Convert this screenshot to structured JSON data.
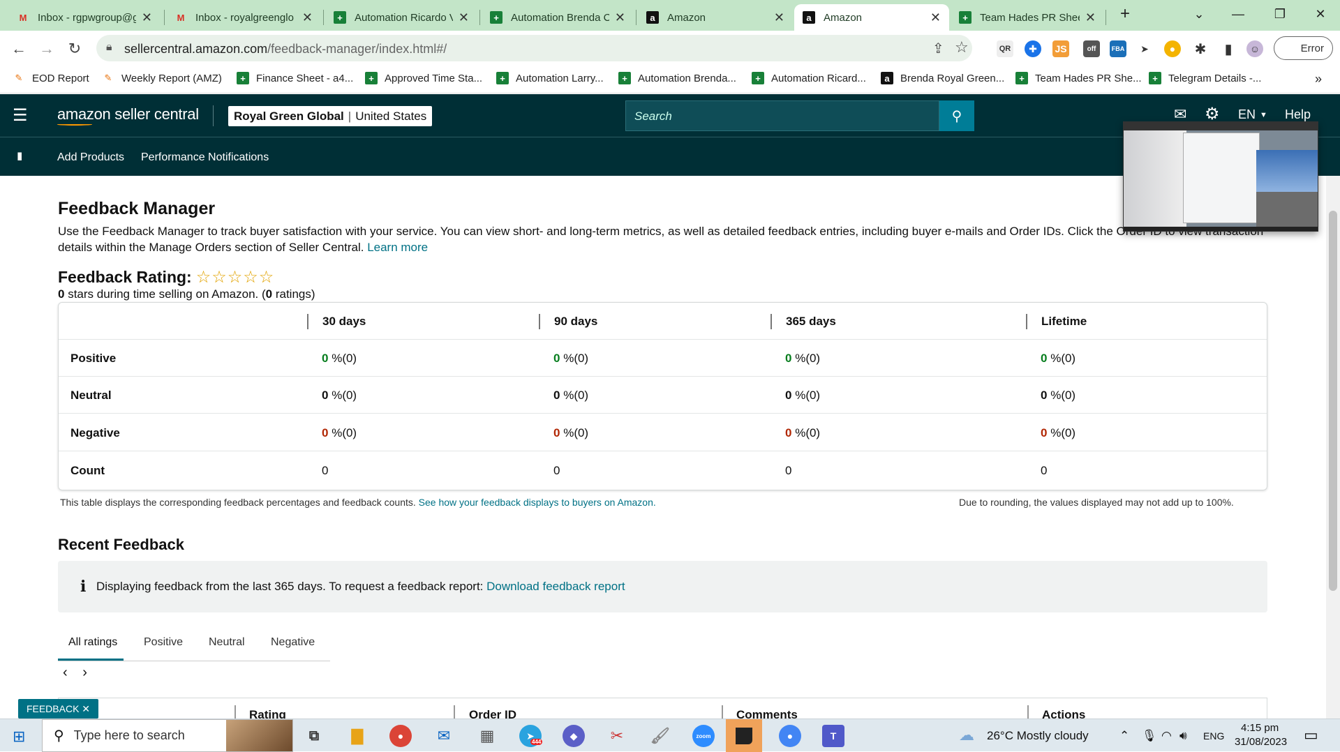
{
  "browser": {
    "tabs": [
      {
        "title": "Inbox - rgpwgroup@g",
        "icon": "gmail-icon"
      },
      {
        "title": "Inbox - royalgreenglo",
        "icon": "gmail-icon"
      },
      {
        "title": "Automation Ricardo V",
        "icon": "sheets-icon"
      },
      {
        "title": "Automation Brenda C",
        "icon": "sheets-icon"
      },
      {
        "title": "Amazon",
        "icon": "amazon-icon"
      },
      {
        "title": "Amazon",
        "icon": "amazon-icon"
      },
      {
        "title": "Team Hades PR Sheet",
        "icon": "sheets-icon"
      }
    ],
    "active_tab": 5,
    "url_host": "sellercentral.amazon.com",
    "url_path": "/feedback-manager/index.html#/",
    "profile_error": "Error",
    "bookmarks": [
      {
        "label": "EOD Report",
        "icon": "tools-icon"
      },
      {
        "label": "Weekly Report (AMZ)",
        "icon": "tools-icon"
      },
      {
        "label": "Finance Sheet - a4...",
        "icon": "sheets-icon"
      },
      {
        "label": "Approved Time Sta...",
        "icon": "sheets-icon"
      },
      {
        "label": "Automation Larry...",
        "icon": "sheets-icon"
      },
      {
        "label": "Automation Brenda...",
        "icon": "sheets-icon"
      },
      {
        "label": "Automation Ricard...",
        "icon": "sheets-icon"
      },
      {
        "label": "Brenda Royal Green...",
        "icon": "amazon-icon"
      },
      {
        "label": "Team Hades PR She...",
        "icon": "sheets-icon"
      },
      {
        "label": "Telegram Details -...",
        "icon": "sheets-icon"
      }
    ]
  },
  "header": {
    "logo": "amazon seller central",
    "store_name": "Royal Green Global",
    "marketplace": "United States",
    "search_placeholder": "Search",
    "language": "EN",
    "help": "Help",
    "nav": [
      "Add Products",
      "Performance Notifications"
    ]
  },
  "page": {
    "title": "Feedback Manager",
    "intro": "Use the Feedback Manager to track buyer satisfaction with your service. You can view short- and long-term metrics, as well as detailed feedback entries, including buyer e-mails and Order IDs. Click the Order ID to view transaction details within the Manage Orders section of Seller Central.",
    "learn_more": "Learn more",
    "rating_label": "Feedback Rating:",
    "stars": "☆☆☆☆☆",
    "rating_sub_stars": "0",
    "rating_sub_mid": " stars during time selling on Amazon. (",
    "rating_sub_count": "0",
    "rating_sub_end": " ratings)"
  },
  "table": {
    "columns": [
      "30 days",
      "90 days",
      "365 days",
      "Lifetime"
    ],
    "rows": [
      {
        "label": "Positive",
        "values": [
          "0",
          "0",
          "0",
          "0"
        ],
        "suffix": "%(0)",
        "color": "#067d1d"
      },
      {
        "label": "Neutral",
        "values": [
          "0",
          "0",
          "0",
          "0"
        ],
        "suffix": "%(0)",
        "color": "#111111"
      },
      {
        "label": "Negative",
        "values": [
          "0",
          "0",
          "0",
          "0"
        ],
        "suffix": "%(0)",
        "color": "#b12704"
      },
      {
        "label": "Count",
        "values": [
          "0",
          "0",
          "0",
          "0"
        ],
        "suffix": "",
        "color": "#111111"
      }
    ],
    "note_left": "This table displays the corresponding feedback percentages and feedback counts.",
    "note_link": "See how your feedback displays to buyers on Amazon.",
    "note_right": "Due to rounding, the values displayed may not add up to 100%."
  },
  "recent": {
    "title": "Recent Feedback",
    "info_text": "Displaying feedback from the last 365 days. To request a feedback report:",
    "info_link": "Download feedback report",
    "tabs": [
      "All ratings",
      "Positive",
      "Neutral",
      "Negative"
    ],
    "columns": [
      ".",
      "Rating",
      "Order ID",
      "Comments",
      "Actions"
    ],
    "feedback_tag": "FEEDBACK ✕"
  },
  "taskbar": {
    "search_placeholder": "Type here to search",
    "weather": "26°C  Mostly cloudy",
    "lang": "ENG",
    "time": "4:15 pm",
    "date": "31/08/2023",
    "telegram_badge": "444"
  },
  "colors": {
    "header_bg": "#002f36",
    "link": "#007185",
    "positive": "#067d1d",
    "negative": "#b12704",
    "tabbar": "#c3e5c8"
  }
}
